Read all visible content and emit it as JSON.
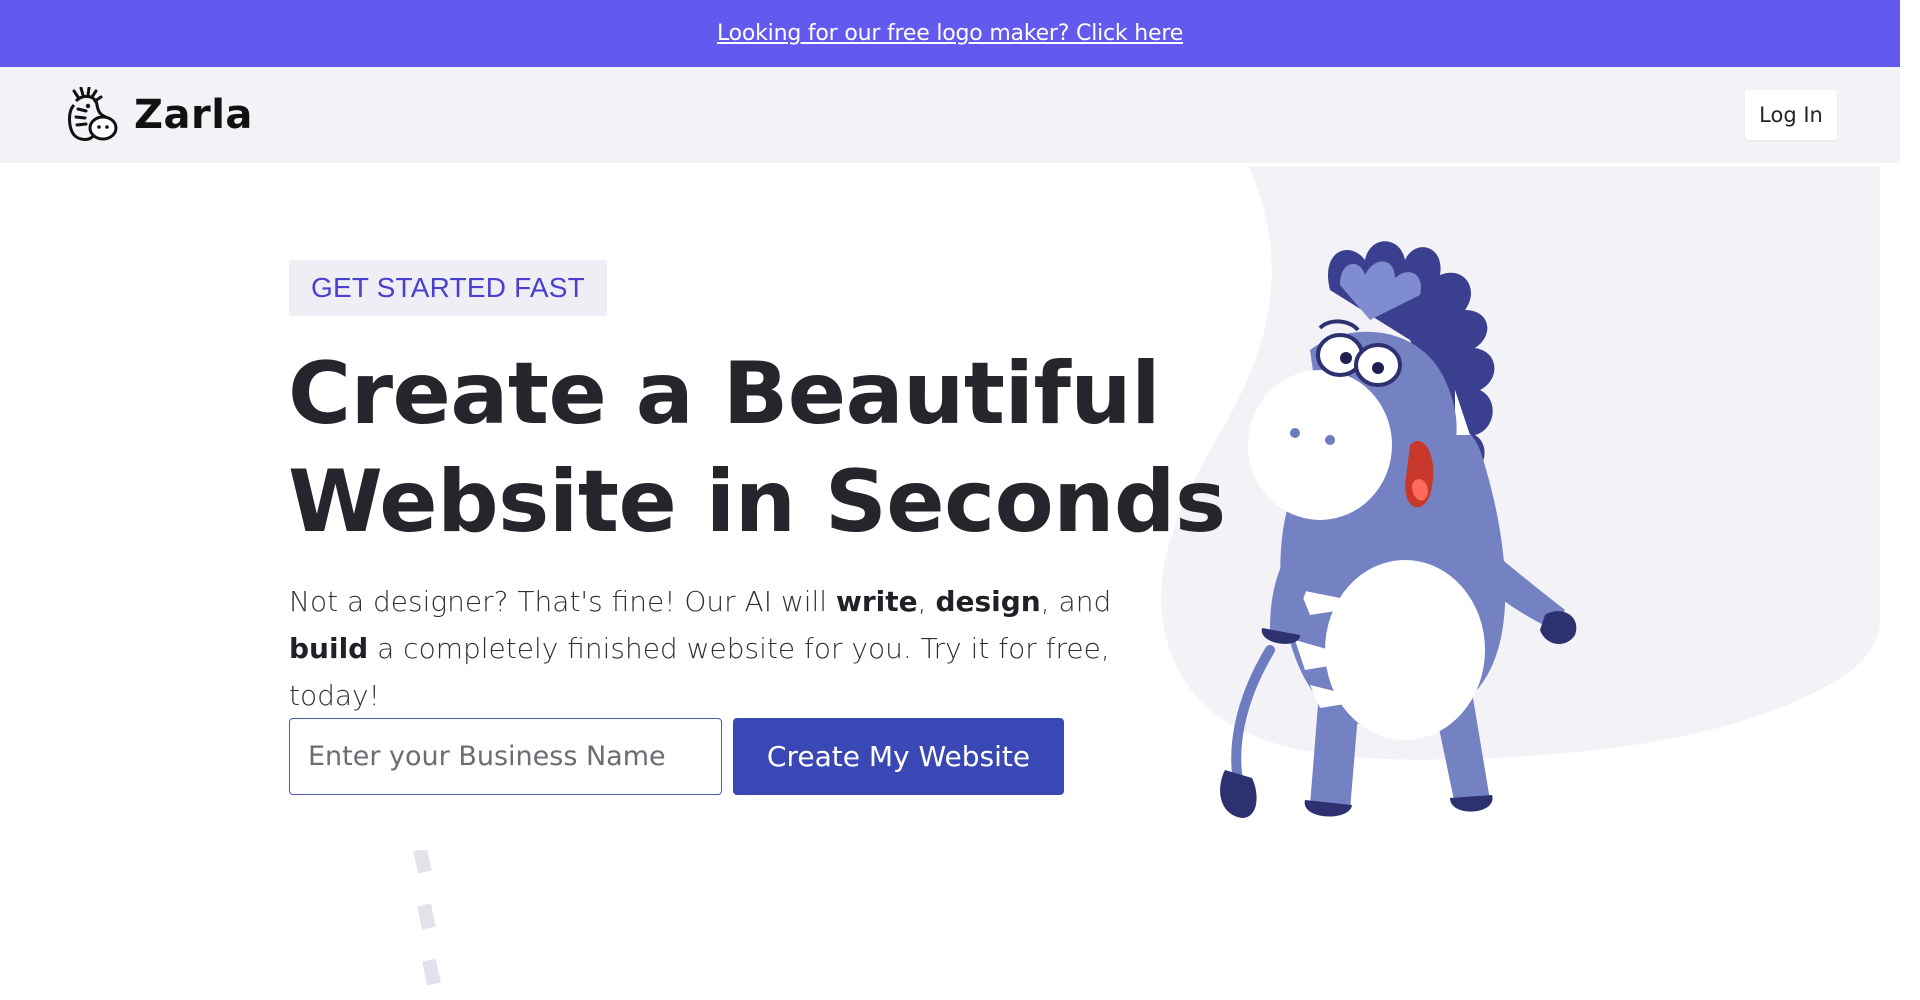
{
  "promo": {
    "link_text": "Looking for our free logo maker? Click here"
  },
  "header": {
    "brand": "Zarla",
    "login_label": "Log In"
  },
  "hero": {
    "badge": "GET STARTED FAST",
    "headline_line1": "Create a Beautiful",
    "headline_line2": "Website in Seconds",
    "sub": {
      "part1": "Not a designer? That's fine! Our AI will ",
      "bold1": "write",
      "sep1": ", ",
      "bold2": "design",
      "sep2": ", and ",
      "bold3": "build",
      "part2": " a completely finished website for you. Try it for free, today!"
    },
    "input_placeholder": "Enter your Business Name",
    "cta_label": "Create My Website"
  },
  "icons": {
    "logo": "zebra-logo-icon",
    "mascot": "zebra-mascot-illustration"
  },
  "colors": {
    "promo_bg": "#6259ef",
    "header_bg": "#f3f2f6",
    "badge_text": "#4a3fd0",
    "cta_bg": "#3a48b5",
    "mascot_body": "#7482c4"
  }
}
